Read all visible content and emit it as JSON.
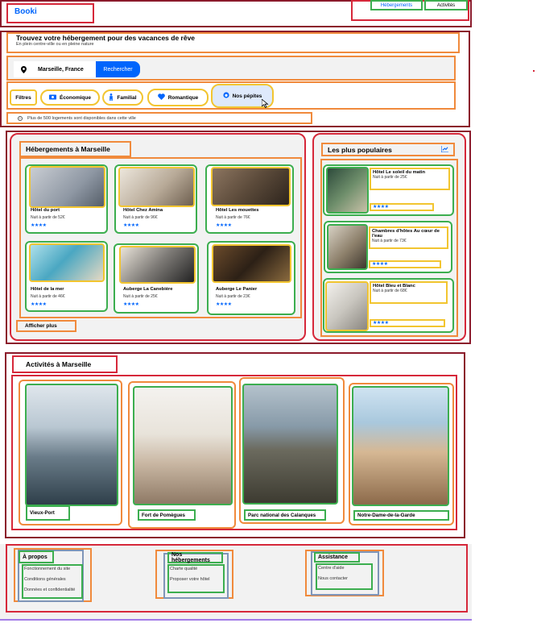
{
  "header": {
    "logo": "Booki",
    "nav": [
      "Hébergements",
      "Activités"
    ]
  },
  "hero": {
    "title": "Trouvez votre hébergement pour des vacances de rêve",
    "subtitle": "En plein centre-ville ou en pleine nature"
  },
  "search": {
    "value": "Marseille, France",
    "button": "Rechercher"
  },
  "filters": {
    "label": "Filtres",
    "chips": [
      "Économique",
      "Familial",
      "Romantique",
      "Nos pépites"
    ]
  },
  "info": {
    "icon": "info-icon",
    "text": "Plus de 500 logements sont disponibles dans cette ville"
  },
  "lodging": {
    "title": "Hébergements à Marseille",
    "more": "Afficher plus",
    "cards": [
      {
        "name": "Hôtel du port",
        "price": "Nuit à partir de 52€",
        "stars": "★★★★"
      },
      {
        "name": "Hôtel Chez Amina",
        "price": "Nuit à partir de 96€",
        "stars": "★★★★"
      },
      {
        "name": "Hôtel Les mouettes",
        "price": "Nuit à partir de 76€",
        "stars": "★★★★"
      },
      {
        "name": "Hôtel de la mer",
        "price": "Nuit à partir de 46€",
        "stars": "★★★★"
      },
      {
        "name": "Auberge La Canebière",
        "price": "Nuit à partir de 25€",
        "stars": "★★★★"
      },
      {
        "name": "Auberge Le Panier",
        "price": "Nuit à partir de 23€",
        "stars": "★★★★"
      }
    ]
  },
  "popular": {
    "title": "Les plus populaires",
    "icon": "trend-chart-icon",
    "cards": [
      {
        "name": "Hôtel Le soleil du matin",
        "price": "Nuit à partir de 25€",
        "stars": "★★★★"
      },
      {
        "name": "Chambres d'hôtes Au cœur de l'eau",
        "price": "Nuit à partir de 73€",
        "stars": "★★★★"
      },
      {
        "name": "Hôtel Bleu et Blanc",
        "price": "Nuit à partir de 68€",
        "stars": "★★★★"
      }
    ]
  },
  "activities": {
    "title": "Activités à Marseille",
    "items": [
      "Vieux-Port",
      "Fort de Pomègues",
      "Parc national des Calanques",
      "Notre-Dame-de-la-Garde"
    ]
  },
  "footer": {
    "cols": [
      {
        "title": "À propos",
        "links": [
          "Fonctionnement du site",
          "Conditions générales",
          "Données et confidentialité"
        ]
      },
      {
        "title": "Nos hébergements",
        "links": [
          "Charte qualité",
          "Proposer votre hôtel"
        ]
      },
      {
        "title": "Assistance",
        "links": [
          "Centre d'aide",
          "Nous contacter"
        ]
      }
    ]
  },
  "colors": {
    "brand": "#0065fc",
    "panel": "#f2f2f2"
  }
}
